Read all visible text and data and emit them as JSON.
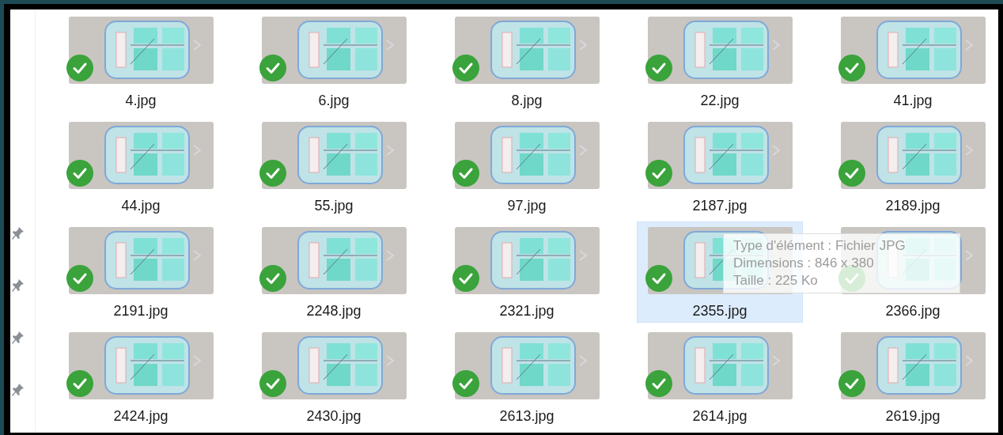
{
  "sidebar": [
    {
      "pinned": true
    },
    {
      "pinned": true
    },
    {
      "pinned": true
    },
    {
      "pinned": true
    }
  ],
  "files": [
    {
      "name": "4.jpg",
      "synced": true,
      "selected": false
    },
    {
      "name": "6.jpg",
      "synced": true,
      "selected": false
    },
    {
      "name": "8.jpg",
      "synced": true,
      "selected": false
    },
    {
      "name": "22.jpg",
      "synced": true,
      "selected": false
    },
    {
      "name": "41.jpg",
      "synced": true,
      "selected": false
    },
    {
      "name": "44.jpg",
      "synced": true,
      "selected": false
    },
    {
      "name": "55.jpg",
      "synced": true,
      "selected": false
    },
    {
      "name": "97.jpg",
      "synced": true,
      "selected": false
    },
    {
      "name": "2187.jpg",
      "synced": true,
      "selected": false
    },
    {
      "name": "2189.jpg",
      "synced": true,
      "selected": false
    },
    {
      "name": "2191.jpg",
      "synced": true,
      "selected": false
    },
    {
      "name": "2248.jpg",
      "synced": true,
      "selected": false
    },
    {
      "name": "2321.jpg",
      "synced": true,
      "selected": false
    },
    {
      "name": "2355.jpg",
      "synced": true,
      "selected": true
    },
    {
      "name": "2366.jpg",
      "synced": true,
      "selected": false
    },
    {
      "name": "2424.jpg",
      "synced": true,
      "selected": false
    },
    {
      "name": "2430.jpg",
      "synced": true,
      "selected": false
    },
    {
      "name": "2613.jpg",
      "synced": true,
      "selected": false
    },
    {
      "name": "2614.jpg",
      "synced": true,
      "selected": false
    },
    {
      "name": "2619.jpg",
      "synced": true,
      "selected": false
    }
  ],
  "tooltip": {
    "lines": [
      "Type d'élément : Fichier JPG",
      "Dimensions : 846 x 380",
      "Taille : 225 Ko"
    ]
  }
}
